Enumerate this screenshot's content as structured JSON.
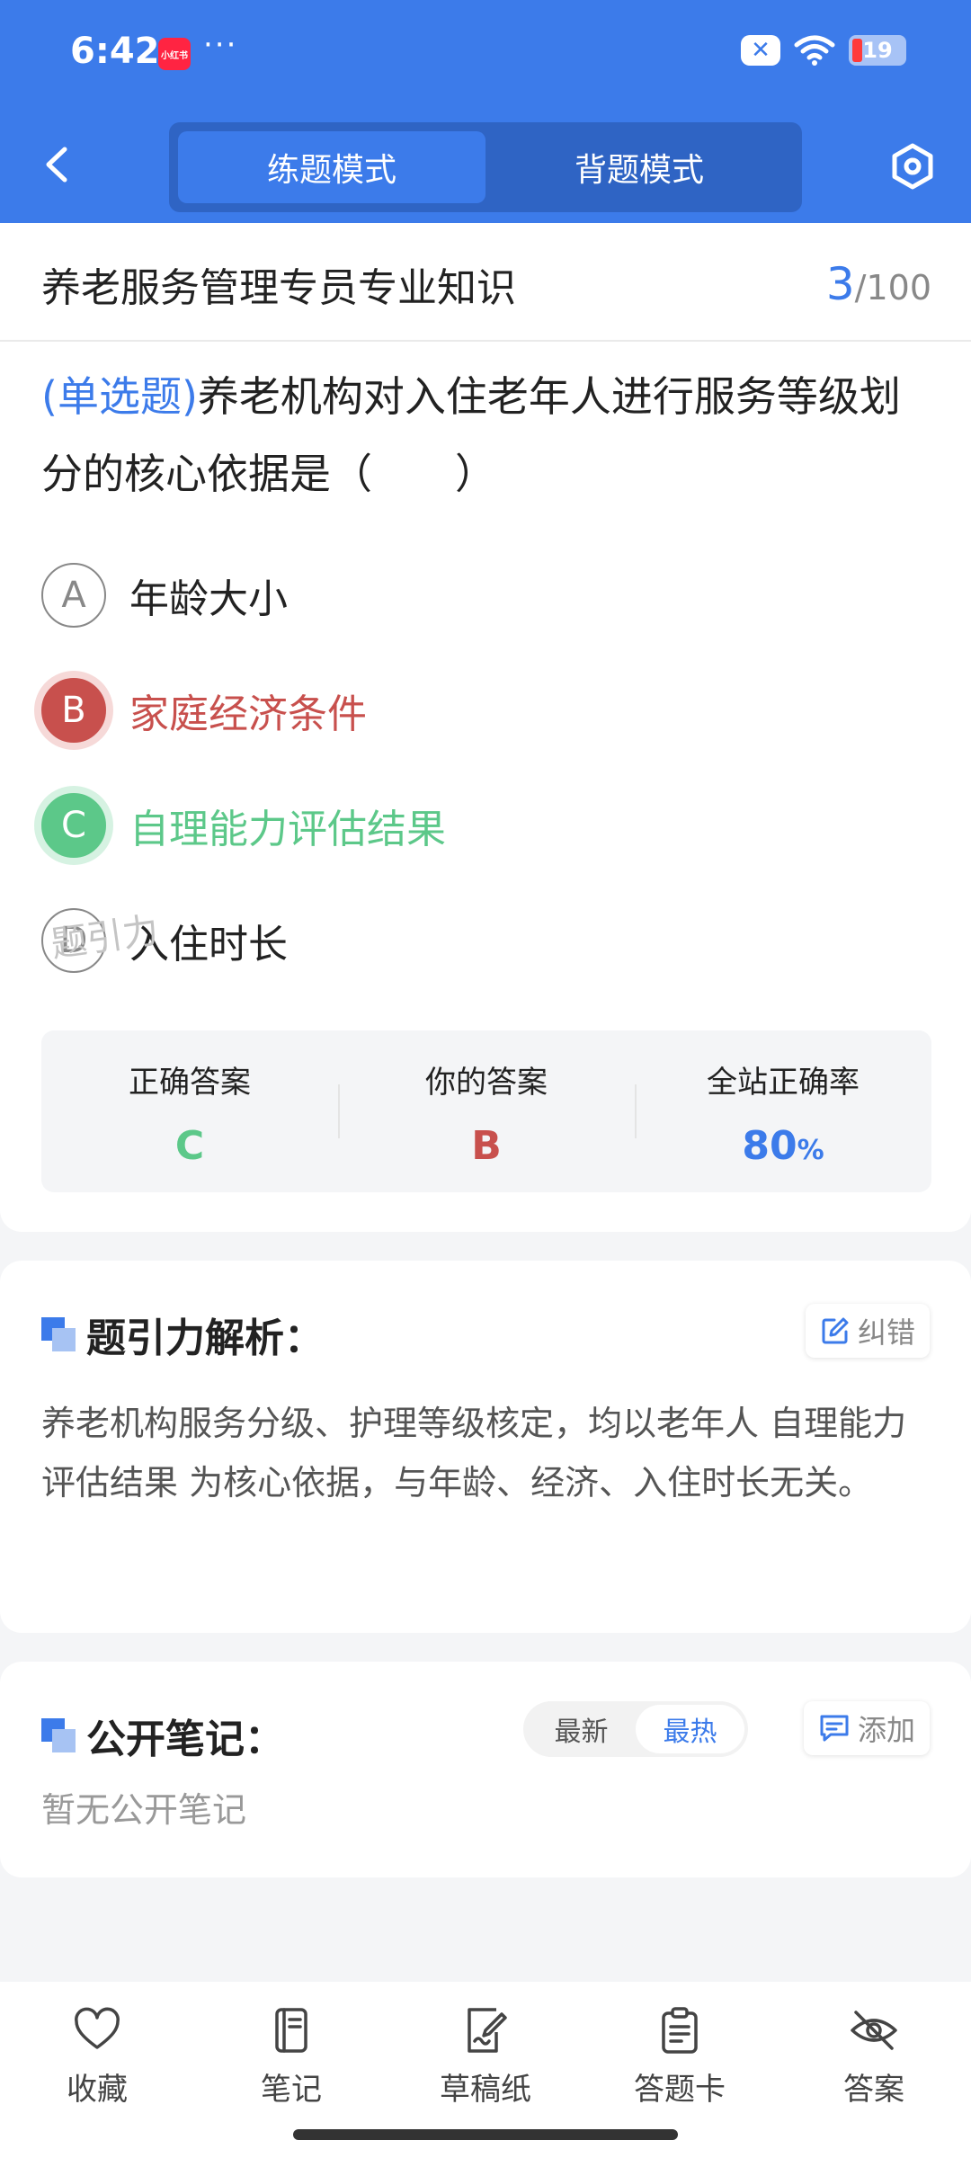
{
  "status_bar": {
    "time": "6:42",
    "app_badge": "小红书",
    "more": "···",
    "battery": "19",
    "battery_level": 0.19
  },
  "header": {
    "tabs": [
      {
        "label": "练题模式",
        "active": true
      },
      {
        "label": "背题模式",
        "active": false
      }
    ],
    "accent_color": "#3c7bea"
  },
  "question_card": {
    "subject": "养老服务管理专员专业知识",
    "current": "3",
    "total": "/100",
    "type_label": "(单选题)",
    "question": "养老机构对入住老年人进行服务等级划分的核心依据是（　　）",
    "options": [
      {
        "letter": "A",
        "text": "年龄大小",
        "state": "normal"
      },
      {
        "letter": "B",
        "text": "家庭经济条件",
        "state": "wrong",
        "color": "#c8504d"
      },
      {
        "letter": "C",
        "text": "自理能力评估结果",
        "state": "correct",
        "color": "#5cc889"
      },
      {
        "letter": "D",
        "text": "入住时长",
        "state": "normal"
      }
    ],
    "stats": {
      "correct_label": "正确答案",
      "correct_value": "C",
      "yours_label": "你的答案",
      "yours_value": "B",
      "rate_label": "全站正确率",
      "rate_value": "80",
      "rate_unit": "%"
    },
    "watermark": "题引力"
  },
  "analysis": {
    "title": "题引力解析：",
    "report_label": "纠错",
    "text": "养老机构服务分级、护理等级核定，均以老年人 自理能力评估结果 为核心依据，与年龄、经济、入住时长无关。"
  },
  "notes": {
    "title": "公开笔记：",
    "sort_options": [
      {
        "label": "最新",
        "active": false
      },
      {
        "label": "最热",
        "active": true
      }
    ],
    "add_label": "添加",
    "empty_text": "暂无公开笔记"
  },
  "bottom_nav": [
    {
      "label": "收藏",
      "icon": "heart-icon"
    },
    {
      "label": "笔记",
      "icon": "notebook-icon"
    },
    {
      "label": "草稿纸",
      "icon": "draft-paper-icon"
    },
    {
      "label": "答题卡",
      "icon": "answer-card-icon"
    },
    {
      "label": "答案",
      "icon": "eye-off-icon"
    }
  ]
}
